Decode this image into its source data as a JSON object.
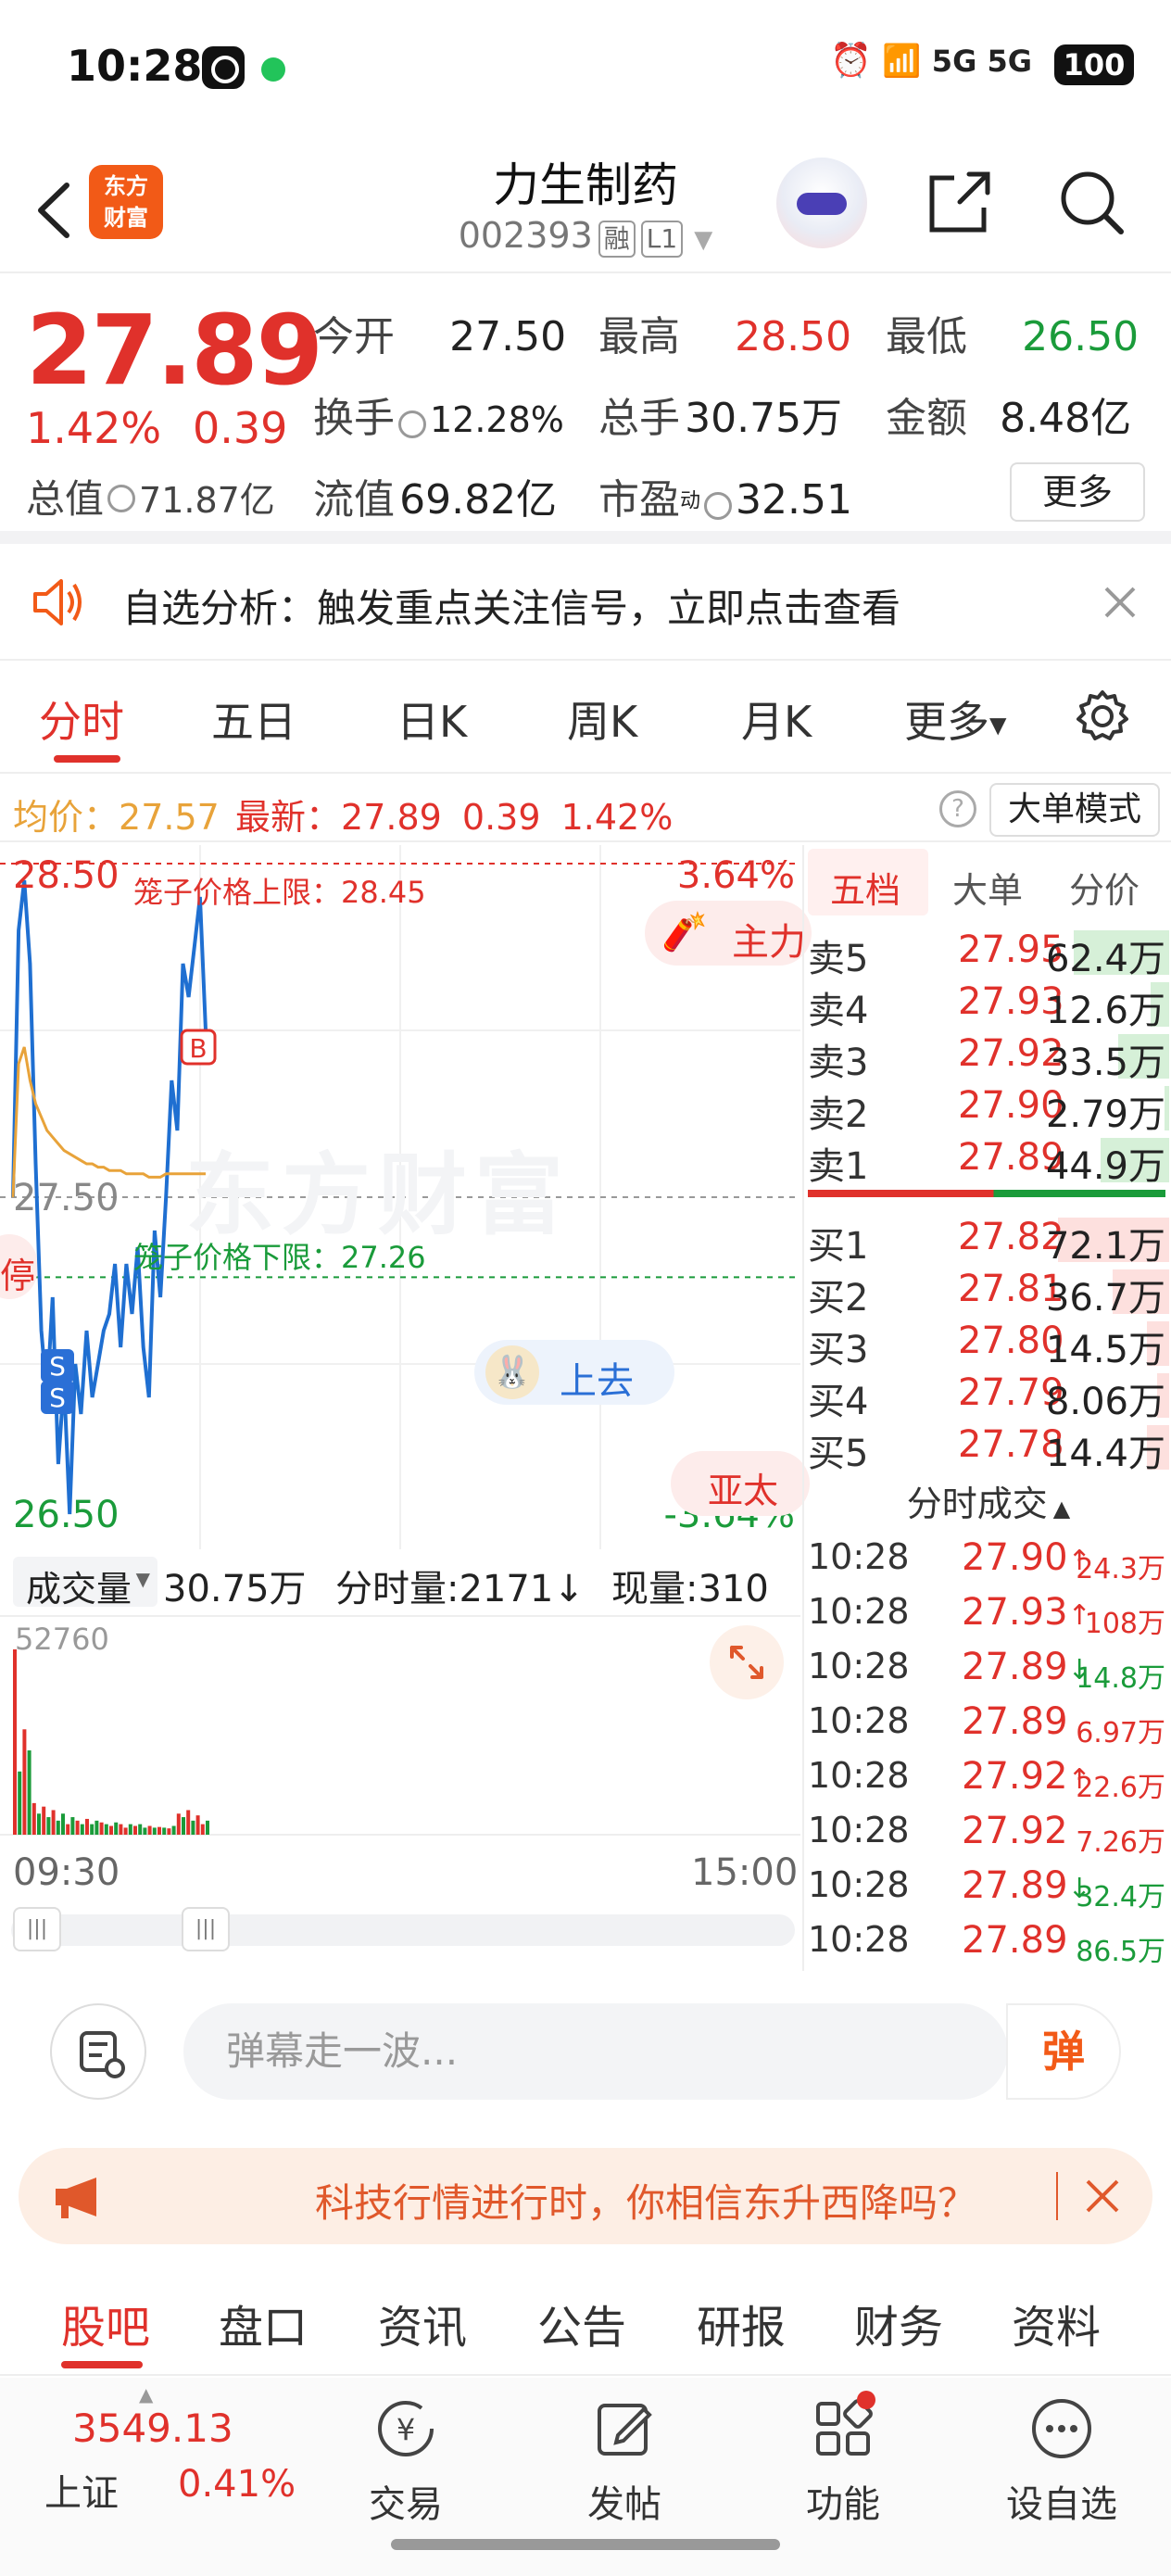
{
  "status_bar": {
    "time": "10:28",
    "signal": "5G 5G",
    "battery": "100"
  },
  "header": {
    "brand_logo": "东方\n财富",
    "stock_name": "力生制药",
    "stock_code": "002393",
    "badge_margin": "融",
    "badge_level": "L1",
    "icons": [
      "back-arrow-icon",
      "robot-avatar",
      "share-icon",
      "search-icon"
    ]
  },
  "quote": {
    "price": "27.89",
    "change_pct": "1.42%",
    "change_amt": "0.39",
    "total_cap_label": "总值",
    "total_cap_value": "71.87亿",
    "open_label": "今开",
    "open_value": "27.50",
    "high_label": "最高",
    "high_value": "28.50",
    "low_label": "最低",
    "low_value": "26.50",
    "turnover_label": "换手",
    "turnover_value": "12.28%",
    "total_hands_label": "总手",
    "total_hands_value": "30.75万",
    "amount_label": "金额",
    "amount_value": "8.48亿",
    "float_cap_label": "流值",
    "float_cap_value": "69.82亿",
    "pe_label": "市盈",
    "pe_sup": "动",
    "pe_value": "32.51",
    "more_label": "更多"
  },
  "notice": {
    "text": "自选分析：触发重点关注信号，立即点击查看"
  },
  "tabs": {
    "items": [
      "分时",
      "五日",
      "日K",
      "周K",
      "月K",
      "更多"
    ],
    "active": "分时"
  },
  "avg_row": {
    "avg_label": "均价：",
    "avg_value": "27.57",
    "latest_label": "最新：",
    "latest_value": "27.89",
    "latest_chg": "0.39",
    "latest_pct": "1.42%",
    "big_mode": "大单模式"
  },
  "chart": {
    "top_price": "28.50",
    "top_pct": "3.64%",
    "mid_price": "27.50",
    "bottom_price": "26.50",
    "bottom_pct": "-3.64%",
    "upper_limit_label": "笼子价格上限：28.45",
    "lower_limit_label": "笼子价格下限：27.26",
    "tag_main": "主力",
    "tag_halt": "停",
    "tag_up": "上去",
    "tag_asia": "亚太",
    "marker_b": "B",
    "marker_s": "S",
    "watermark": "东方财富"
  },
  "chart_data": {
    "type": "line",
    "title": "",
    "series": [
      {
        "name": "",
        "color": "#1f6fd1",
        "values": [
          27.5,
          28.3,
          28.45,
          28.2,
          27.6,
          27.1,
          26.9,
          27.2,
          26.7,
          26.95,
          26.55,
          27.0,
          26.85,
          27.1,
          26.9,
          27.0,
          27.1,
          27.15,
          27.3,
          27.05,
          27.3,
          27.15,
          27.35,
          27.05,
          26.9,
          27.4,
          27.2,
          27.5,
          27.85,
          27.7,
          28.2,
          28.1,
          28.25,
          28.4,
          28.0
        ]
      },
      {
        "name": "",
        "color": "#e8a33a",
        "values": [
          27.5,
          27.9,
          27.95,
          27.85,
          27.78,
          27.74,
          27.7,
          27.68,
          27.66,
          27.64,
          27.63,
          27.62,
          27.61,
          27.6,
          27.6,
          27.59,
          27.59,
          27.58,
          27.58,
          27.58,
          27.57,
          27.57,
          27.57,
          27.57,
          27.56,
          27.56,
          27.56,
          27.57,
          27.57,
          27.57,
          27.57,
          27.57,
          27.57,
          27.57,
          27.57
        ]
      }
    ],
    "ylim": [
      26.5,
      28.5
    ],
    "y_ticks": [
      "28.50",
      "27.50",
      "26.50"
    ],
    "x_ticks": [
      "09:30",
      "15:00"
    ]
  },
  "volume": {
    "label": "成交量",
    "total": "30.75万",
    "minute_label": "分时量:2171↓",
    "now_label": "现量:310",
    "scale_max": "52760",
    "bars": [
      52760,
      18000,
      30000,
      24000,
      9000,
      6000,
      8000,
      5000,
      7000,
      4000,
      6000,
      3000,
      5000,
      4000,
      3000,
      4500,
      3000,
      4000,
      3500,
      3000,
      2500,
      3500,
      3000,
      2000,
      3000,
      2500,
      3000,
      2000,
      2500,
      2000,
      2200,
      2000,
      1800,
      2500,
      6000,
      5000,
      7000,
      4000,
      5500,
      3000,
      4000
    ],
    "bar_colors": [
      "r",
      "g",
      "r",
      "g",
      "r",
      "g",
      "r",
      "g",
      "r",
      "g",
      "g",
      "r",
      "g",
      "r",
      "g",
      "r",
      "g",
      "g",
      "r",
      "g",
      "r",
      "g",
      "r",
      "r",
      "g",
      "r",
      "g",
      "g",
      "r",
      "g",
      "r",
      "g",
      "r",
      "g",
      "r",
      "g",
      "r",
      "g",
      "r",
      "r",
      "g"
    ],
    "time_start": "09:30",
    "time_end": "15:00"
  },
  "orderbook": {
    "tabs": [
      "五档",
      "大单",
      "分价"
    ],
    "sells": [
      {
        "label": "卖5",
        "price": "27.95",
        "vol": "62.4万",
        "fill": 0.86
      },
      {
        "label": "卖4",
        "price": "27.93",
        "vol": "12.6万",
        "fill": 0.17
      },
      {
        "label": "卖3",
        "price": "27.92",
        "vol": "33.5万",
        "fill": 0.46
      },
      {
        "label": "卖2",
        "price": "27.90",
        "vol": "2.79万",
        "fill": 0.04
      },
      {
        "label": "卖1",
        "price": "27.89",
        "vol": "44.9万",
        "fill": 0.62
      }
    ],
    "buys": [
      {
        "label": "买1",
        "price": "27.82",
        "vol": "72.1万",
        "fill": 1.0
      },
      {
        "label": "买2",
        "price": "27.81",
        "vol": "36.7万",
        "fill": 0.51
      },
      {
        "label": "买3",
        "price": "27.80",
        "vol": "14.5万",
        "fill": 0.2
      },
      {
        "label": "买4",
        "price": "27.79",
        "vol": "8.06万",
        "fill": 0.11
      },
      {
        "label": "买5",
        "price": "27.78",
        "vol": "14.4万",
        "fill": 0.2
      }
    ],
    "trades_title": "分时成交",
    "trades": [
      {
        "time": "10:28",
        "price": "27.90",
        "arrow": "↑",
        "vol": "24.3万",
        "dir": "up"
      },
      {
        "time": "10:28",
        "price": "27.93",
        "arrow": "↑",
        "vol": "108万",
        "dir": "up"
      },
      {
        "time": "10:28",
        "price": "27.89",
        "arrow": "↓",
        "vol": "14.8万",
        "dir": "down"
      },
      {
        "time": "10:28",
        "price": "27.89",
        "arrow": "",
        "vol": "6.97万",
        "dir": "up"
      },
      {
        "time": "10:28",
        "price": "27.92",
        "arrow": "↑",
        "vol": "22.6万",
        "dir": "up"
      },
      {
        "time": "10:28",
        "price": "27.92",
        "arrow": "",
        "vol": "7.26万",
        "dir": "up"
      },
      {
        "time": "10:28",
        "price": "27.89",
        "arrow": "↓",
        "vol": "32.4万",
        "dir": "down"
      },
      {
        "time": "10:28",
        "price": "27.89",
        "arrow": "",
        "vol": "86.5万",
        "dir": "down"
      }
    ]
  },
  "danmu": {
    "placeholder": "弹幕走一波...",
    "button": "弹"
  },
  "promo": {
    "text": "科技行情进行时，你相信东升西降吗？"
  },
  "subtabs": {
    "items": [
      "股吧",
      "盘口",
      "资讯",
      "公告",
      "研报",
      "财务",
      "资料"
    ],
    "active": "股吧"
  },
  "bottomnav": {
    "index_value": "3549.13",
    "index_name": "上证",
    "index_pct": "0.41%",
    "items": [
      {
        "label": "交易",
        "icon": "yuan-exchange-icon"
      },
      {
        "label": "发帖",
        "icon": "edit-icon"
      },
      {
        "label": "功能",
        "icon": "grid-icon"
      },
      {
        "label": "设自选",
        "icon": "more-icon"
      }
    ]
  },
  "colors": {
    "up": "#e0312b",
    "down": "#1a9b3a",
    "line": "#1f6fd1",
    "avg": "#e8a33a",
    "accent": "#f25a17"
  }
}
